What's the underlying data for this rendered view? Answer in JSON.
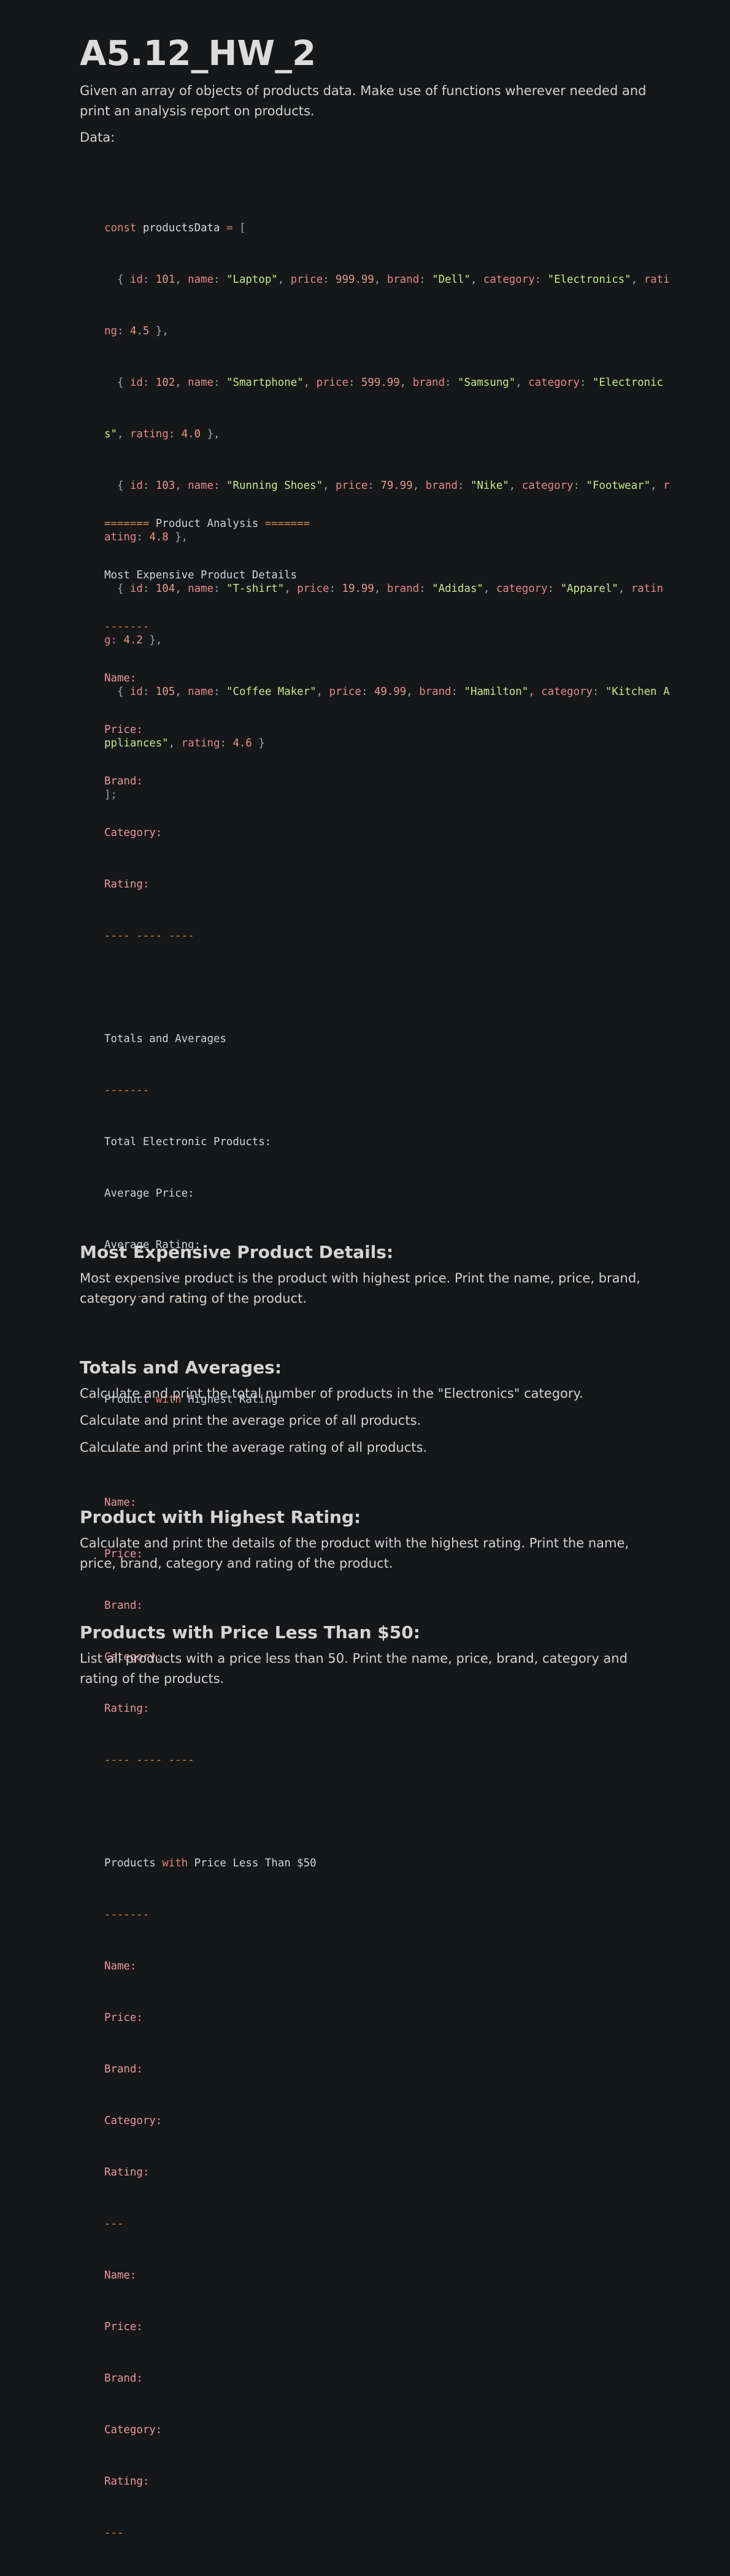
{
  "title": "A5.12_HW_2",
  "intro": "Given an array of objects of products data. Make use of functions wherever needed and print an analysis report on products.",
  "data_label": "Data:",
  "code": {
    "line1": {
      "kw": "const",
      "name": "productsData",
      "eq": "=",
      "open": "["
    },
    "products": [
      {
        "id": "101",
        "name": "\"Laptop\"",
        "price": "999.99",
        "brand": "\"Dell\"",
        "category": "\"Electronics\"",
        "rating": "4.5"
      },
      {
        "id": "102",
        "name": "\"Smartphone\"",
        "price": "599.99",
        "brand": "\"Samsung\"",
        "category": "\"Electronics\"",
        "rating": "4.0"
      },
      {
        "id": "103",
        "name": "\"Running Shoes\"",
        "price": "79.99",
        "brand": "\"Nike\"",
        "category": "\"Footwear\"",
        "rating": "4.8"
      },
      {
        "id": "104",
        "name": "\"T-shirt\"",
        "price": "19.99",
        "brand": "\"Adidas\"",
        "category": "\"Apparel\"",
        "rating": "4.2"
      },
      {
        "id": "105",
        "name": "\"Coffee Maker\"",
        "price": "49.99",
        "brand": "\"Hamilton\"",
        "category": "\"Kitchen Appliances\"",
        "rating": "4.6"
      }
    ],
    "close": "];"
  },
  "output": {
    "header_l": "=======",
    "header_text": "Product Analysis",
    "header_r": "=======",
    "most_expensive": "Most Expensive Product Details",
    "dashes": "-------",
    "name": "Name:",
    "price": "Price:",
    "brand": "Brand:",
    "category": "Category:",
    "rating": "Rating:",
    "sep": "---- ---- ----",
    "totals": "Totals and Averages",
    "total_electronic": "Total Electronic Products:",
    "avg_price": "Average Price:",
    "avg_rating": "Average Rating:",
    "highest_pre": "Product",
    "with": "with",
    "highest_post": "Highest Rating",
    "less_pre": "Products",
    "less_post": "Price Less Than $50",
    "short_sep": "---"
  },
  "sections": [
    {
      "title": "Most Expensive Product Details:",
      "paras": [
        "Most expensive product is the product with highest price. Print the name, price, brand, category and rating of the product."
      ]
    },
    {
      "title": "Totals and Averages:",
      "paras": [
        "Calculate and print the total number of products in the \"Electronics\" category.",
        "Calculate and print the average price of all products.",
        "Calculate and print the average rating of all products."
      ]
    },
    {
      "title": "Product with Highest Rating:",
      "paras": [
        "Calculate and print the details of the product with the highest rating. Print the name, price, brand, category and rating of the product."
      ]
    },
    {
      "title": "Products with Price Less Than $50:",
      "paras": [
        "List all products with a price less than 50. Print the name, price, brand, category and rating of the products."
      ]
    }
  ]
}
